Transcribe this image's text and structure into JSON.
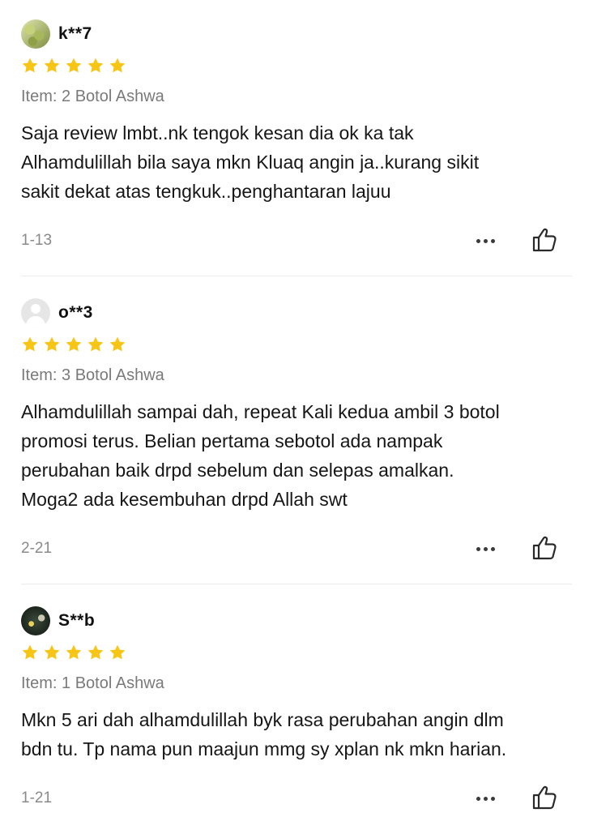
{
  "colors": {
    "star": "#f7c515",
    "muted": "#7a7a7a",
    "text": "#161616"
  },
  "reviews": [
    {
      "username": "k**7",
      "avatar": "leaf-photo-avatar",
      "rating": 5,
      "item": "Item: 2 Botol Ashwa",
      "text_lines": [
        "Saja review lmbt..nk tengok kesan dia ok ka tak",
        "Alhamdulillah bila saya mkn Kluaq angin ja..kurang sikit",
        "sakit dekat atas tengkuk..penghantaran lajuu"
      ],
      "date": "1-13"
    },
    {
      "username": "o**3",
      "avatar": "default-avatar",
      "rating": 5,
      "item": "Item: 3 Botol Ashwa",
      "text_lines": [
        "Alhamdulillah sampai dah, repeat Kali kedua ambil 3 botol",
        "promosi terus.  Belian pertama sebotol ada nampak",
        "perubahan baik drpd sebelum dan selepas amalkan.",
        "Moga2 ada kesembuhan drpd Allah swt"
      ],
      "date": "2-21"
    },
    {
      "username": "S**b",
      "avatar": "dark-photo-avatar",
      "rating": 5,
      "item": "Item: 1 Botol Ashwa",
      "text_lines": [
        "Mkn 5 ari dah alhamdulillah byk rasa perubahan angin dlm",
        "bdn tu. Tp nama pun maajun mmg sy xplan nk mkn harian."
      ],
      "date": "1-21"
    }
  ]
}
